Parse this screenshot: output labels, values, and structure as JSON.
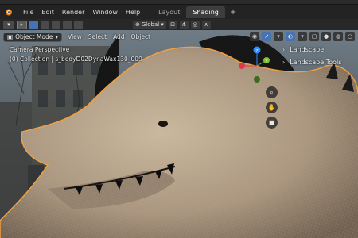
{
  "menubar": {
    "items": [
      "File",
      "Edit",
      "Render",
      "Window",
      "Help"
    ],
    "workspaces": [
      "Layout",
      "Shading"
    ],
    "active_workspace": "Shading",
    "add_tab": "+"
  },
  "toolbar": {
    "transform_orientation": "Global"
  },
  "viewport_header": {
    "mode": "Object Mode",
    "menus": [
      "View",
      "Select",
      "Add",
      "Object"
    ]
  },
  "overlay": {
    "camera_label": "Camera Perspective",
    "collection_label": "(0) Collection | s_bodyD02DynaWax130_009"
  },
  "sidebar": {
    "tabs": [
      "Landscape",
      "Landscape Tools"
    ]
  },
  "gizmo": {
    "z_label": "Z",
    "y_label": "Y",
    "x_color": "#e0384b",
    "y_color": "#7bbf30",
    "z_color": "#2f8cff"
  },
  "colors": {
    "accent": "#4772b3",
    "wire": "#f0a040",
    "background": "#1d1d1d"
  },
  "icons": {
    "logo": "blender-logo-icon",
    "nav": [
      "zoom-icon",
      "hand-icon",
      "camera-icon"
    ]
  }
}
